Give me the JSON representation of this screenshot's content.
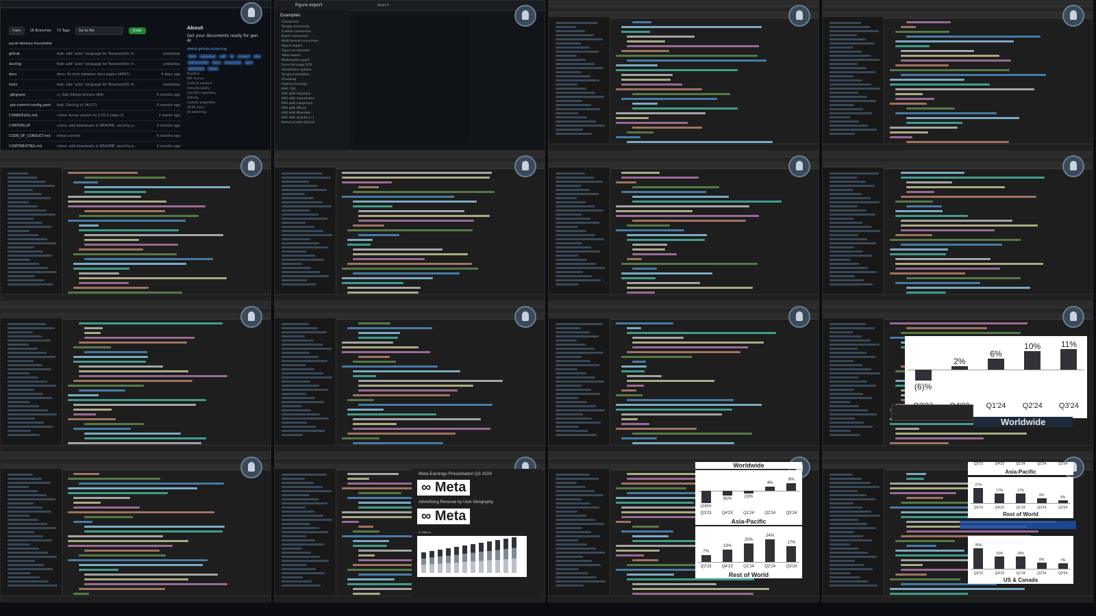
{
  "github": {
    "branch": "main",
    "branches": "18 Branches",
    "tags": "72 Tags",
    "goto": "Go to file",
    "code_btn": "Code",
    "author": "pavel-denisov-fraunhofer",
    "files": [
      {
        "name": "github",
        "msg": "feat: add \"auto\" language for TesseractOcr if...",
        "date": "yesterday"
      },
      {
        "name": "docling",
        "msg": "feat: add \"auto\" language for TesseractOcr if...",
        "date": "yesterday"
      },
      {
        "name": "docs",
        "msg": "docs: fix links between docs pages (#997)",
        "date": "4 days ago"
      },
      {
        "name": "tests",
        "msg": "feat: add \"auto\" language for TesseractOcr if...",
        "date": "yesterday"
      },
      {
        "name": ".gitignore",
        "msg": "ci: Add Github Actions (#4)",
        "date": "6 months ago"
      },
      {
        "name": ".pre-commit-config.yaml",
        "msg": "feat: Docling cli (#117)",
        "date": "5 months ago"
      },
      {
        "name": "CHANGELOG.md",
        "msg": "chore: bump version to 2.15.1 [skip ci]",
        "date": "2 weeks ago"
      },
      {
        "name": "CITATION.cff",
        "msg": "chore: add downloads in README, security p...",
        "date": "2 months ago"
      },
      {
        "name": "CODE_OF_CONDUCT.md",
        "msg": "Initial commit",
        "date": "6 months ago"
      },
      {
        "name": "CONTRIBUTING.md",
        "msg": "chore: add downloads in README, security p...",
        "date": "2 months ago"
      },
      {
        "name": "Dockerfile",
        "msg": "fix: Dockerfile example copy command (#226)",
        "date": "3 months ago"
      }
    ],
    "about_title": "About",
    "about_desc": "Get your documents ready for gen AI",
    "about_link": "ds4sd.github.io/docling",
    "about_tags": [
      "html",
      "markdown",
      "pdf",
      "ai",
      "convert",
      "xlsx",
      "pdf-converter",
      "docx",
      "documents",
      "pptx",
      "pdf-to-text",
      "tables",
      "document-parser",
      "pdf-to-json",
      "document-parsing"
    ],
    "about_items": [
      "Readme",
      "MIT license",
      "Code of conduct",
      "Security policy",
      "Cite this repository",
      "Activity",
      "Custom properties",
      "18.6k stars",
      "64 watching"
    ]
  },
  "figure_export": {
    "title": "Figure export",
    "search": "Search",
    "section": "Examples",
    "items": [
      "Conversion",
      "Simple conversion",
      "Custom conversion",
      "Batch conversion",
      "Multi-format conversion",
      "Figure export",
      "Figure enrichment",
      "Table export",
      "Multimodal export",
      "Force full page OCR",
      "Accelerator options",
      "Simple translation",
      "Chunking",
      "Hybrid chunking",
      "RAG / QA",
      "RAG with Haystack",
      "RAG with LlamaIndex",
      "RAG with LangChain",
      "RAG with Milvus",
      "RAG with Weaviate",
      "RAG with Granite [~]",
      "Retrieval with Qdrant"
    ]
  },
  "worldwide_chart": {
    "title": "Worldwide",
    "chart_data": {
      "type": "bar",
      "categories": [
        "Q3'23",
        "Q4'23",
        "Q1'24",
        "Q2'24",
        "Q3'24"
      ],
      "values": [
        -6,
        2,
        6,
        10,
        11
      ],
      "labels": [
        "(6)%",
        "2%",
        "6%",
        "10%",
        "11%"
      ]
    }
  },
  "meta_doc": {
    "title": "Meta Earnings Presentation Q3 2024",
    "logo": "Meta",
    "subtitle": "Advertising Revenue by User Geography",
    "unit": "In Millions"
  },
  "ws_chart": {
    "title": "Worldwide",
    "chart_data": {
      "type": "bar",
      "categories": [
        "Q3'23",
        "Q4'23",
        "Q1'24",
        "Q2'24",
        "Q3'24"
      ],
      "values": [
        -14,
        -6,
        -3,
        4,
        8
      ],
      "labels": [
        "(14)%",
        "(6)%",
        "(3)%",
        "4%",
        "8%"
      ]
    }
  },
  "ap_chart": {
    "title": "Asia-Pacific",
    "chart_data": {
      "type": "bar",
      "categories": [
        "Q3'23",
        "Q4'23",
        "Q1'24",
        "Q2'24",
        "Q3'24"
      ],
      "values": [
        7,
        13,
        20,
        24,
        17
      ],
      "labels": [
        "7%",
        "13%",
        "20%",
        "24%",
        "17%"
      ]
    }
  },
  "row_label": "Rest of World",
  "row_chart": {
    "title": "Rest of World",
    "chart_data": {
      "type": "bar",
      "categories": [
        "Q3'23",
        "Q4'23",
        "Q1'24",
        "Q2'24",
        "Q3'24"
      ],
      "values": [
        27,
        17,
        17,
        8,
        5
      ],
      "labels": [
        "27%",
        "17%",
        "17%",
        "8%",
        "5%"
      ]
    }
  },
  "us_chart": {
    "title": "US & Canada",
    "chart_data": {
      "type": "bar",
      "categories": [
        "Q3'23",
        "Q4'23",
        "Q1'24",
        "Q2'24",
        "Q3'24"
      ],
      "values": [
        26,
        16,
        16,
        8,
        7
      ],
      "labels": [
        "26%",
        "16%",
        "16%",
        "8%",
        "7%"
      ]
    }
  },
  "ap_label": "Asia-Pacific",
  "ap_ticks": [
    "Q3'23",
    "Q4'23",
    "Q1'24",
    "Q2'24",
    "Q3'24"
  ]
}
